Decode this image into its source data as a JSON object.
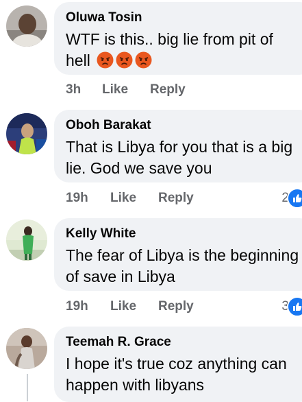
{
  "comments": [
    {
      "author": "Oluwa Tosin",
      "text": "WTF is this.. big lie from pit of hell",
      "time": "3h",
      "like_label": "Like",
      "reply_label": "Reply",
      "reactions_count": "",
      "inline_emojis": [
        "angry-face-emoji",
        "angry-face-emoji",
        "angry-face-emoji"
      ]
    },
    {
      "author": "Oboh Barakat",
      "text": "That is Libya for you that is a big lie. God we save you",
      "time": "19h",
      "like_label": "Like",
      "reply_label": "Reply",
      "reactions_count": "2"
    },
    {
      "author": "Kelly White",
      "text": "The fear of Libya is the beginning of save in Libya",
      "time": "19h",
      "like_label": "Like",
      "reply_label": "Reply",
      "reactions_count": "3"
    },
    {
      "author": "Teemah R. Grace",
      "text": "I hope it's true coz anything can happen with libyans"
    }
  ],
  "colors": {
    "bubble": "#f0f2f5",
    "text": "#050505",
    "secondary": "#65676b",
    "like_blue": "#1877f2",
    "angry": "#e9571f"
  }
}
